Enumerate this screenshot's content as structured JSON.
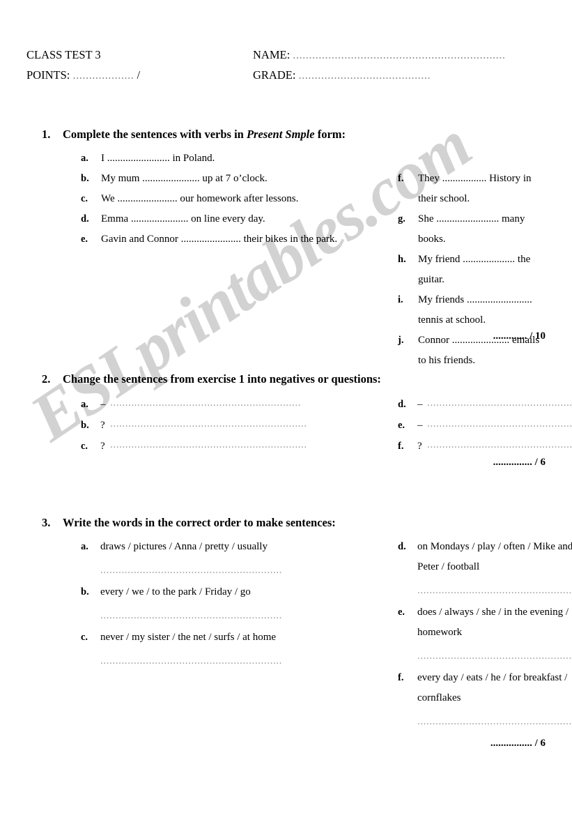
{
  "header": {
    "title": "CLASS TEST 3",
    "points_label": "POINTS:",
    "points_dots": "...................",
    "points_slash": "/",
    "name_label": "NAME:",
    "name_dots": "..................................................................",
    "grade_label": "GRADE:",
    "grade_dots": "........................................."
  },
  "watermark": {
    "text": "ESLprintables.com",
    "color": "#d2d2d2"
  },
  "exercise1": {
    "number": "1.",
    "title_before": "Complete the sentences with verbs in ",
    "title_emphasis": "Present Smple",
    "title_after": " form:",
    "left_items": [
      {
        "mark": "a.",
        "text": "I ........................ in Poland."
      },
      {
        "mark": "b.",
        "text": "My mum ...................... up at 7 o’clock."
      },
      {
        "mark": "c.",
        "text": "We ....................... our homework after lessons."
      },
      {
        "mark": "d.",
        "text": "Emma ...................... on line every day."
      },
      {
        "mark": "e.",
        "text": "Gavin and Connor ....................... their bikes in the park."
      }
    ],
    "right_items": [
      {
        "mark": "f.",
        "text": "They ................. History in their school."
      },
      {
        "mark": "g.",
        "text": "She ........................ many books."
      },
      {
        "mark": "h.",
        "text": "My friend .................... the guitar."
      },
      {
        "mark": "i.",
        "text": "My friends ......................... tennis at school."
      },
      {
        "mark": "j.",
        "text": "Connor ...................... emails to his friends."
      }
    ],
    "score": "............. / 10"
  },
  "exercise2": {
    "number": "2.",
    "title": "Change the sentences from exercise 1 into negatives or questions:",
    "left_items": [
      {
        "mark": "a.",
        "symbol": "–",
        "rule": "..............................................................."
      },
      {
        "mark": "b.",
        "symbol": "?",
        "rule": "................................................................."
      },
      {
        "mark": "c.",
        "symbol": "?",
        "rule": "................................................................."
      }
    ],
    "right_items": [
      {
        "mark": "d.",
        "symbol": "–",
        "rule": "..........................................................."
      },
      {
        "mark": "e.",
        "symbol": "–",
        "rule": "..........................................................."
      },
      {
        "mark": "f.",
        "symbol": "?",
        "rule": "..........................................................."
      }
    ],
    "score": "............... / 6"
  },
  "exercise3": {
    "number": "3.",
    "title": "Write the words in the correct order to make sentences:",
    "left_items": [
      {
        "mark": "a.",
        "text": "draws / pictures / Anna / pretty / usually",
        "rule": "............................................................"
      },
      {
        "mark": "b.",
        "text": "every / we / to the park / Friday / go",
        "rule": "............................................................"
      },
      {
        "mark": "c.",
        "text": "never / my sister / the net / surfs  / at home",
        "rule": "............................................................"
      }
    ],
    "right_items": [
      {
        "mark": "d.",
        "text": "on Mondays / play / often / Mike and Peter / football",
        "rule": "......................................................."
      },
      {
        "mark": "e.",
        "text": "does / always / she / in the evening / homework",
        "rule": "......................................................."
      },
      {
        "mark": "f.",
        "text": "every day / eats / he / for breakfast / cornflakes",
        "rule": "......................................................."
      }
    ],
    "score": "................ / 6"
  }
}
